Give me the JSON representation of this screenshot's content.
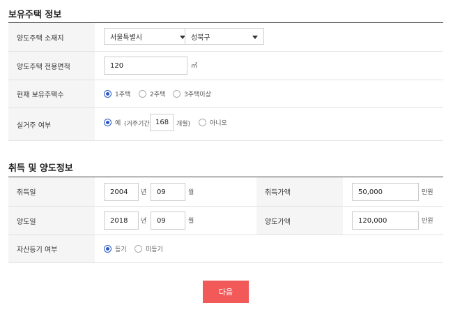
{
  "section1": {
    "title": "보유주택 정보",
    "location": {
      "label": "양도주택 소재지",
      "city": "서울특별시",
      "district": "성북구"
    },
    "area": {
      "label": "양도주택 전용면적",
      "value": "120",
      "unit": "㎡"
    },
    "count": {
      "label": "현재 보유주택수",
      "options": [
        "1주택",
        "2주택",
        "3주택이상"
      ],
      "selected": 0
    },
    "residence": {
      "label": "실거주 여부",
      "yes": "예",
      "period_prefix": "(거주기간 :",
      "months": "168",
      "period_suffix": "개월)",
      "no": "아니오"
    }
  },
  "section2": {
    "title": "취득 및 양도정보",
    "acquire": {
      "label": "취득일",
      "year": "2004",
      "year_unit": "년",
      "month": "09",
      "month_unit": "월",
      "price_label": "취득가액",
      "price": "50,000",
      "price_unit": "만원"
    },
    "transfer": {
      "label": "양도일",
      "year": "2018",
      "year_unit": "년",
      "month": "09",
      "month_unit": "월",
      "price_label": "양도가액",
      "price": "120,000",
      "price_unit": "만원"
    },
    "registered": {
      "label": "자산등기 여부",
      "options": [
        "등기",
        "미등기"
      ],
      "selected": 0
    }
  },
  "next_button": "다음"
}
